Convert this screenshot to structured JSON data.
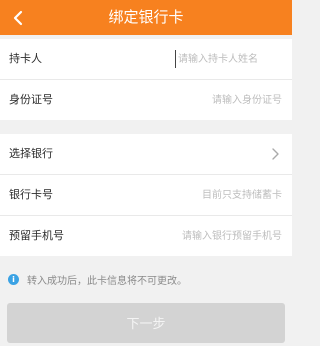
{
  "header": {
    "title": "绑定银行卡",
    "back_icon": "chevron-left-icon",
    "color": "#f7811f"
  },
  "section1": {
    "rows": [
      {
        "label": "持卡人",
        "placeholder": "请输入持卡人姓名",
        "value": ""
      },
      {
        "label": "身份证号",
        "placeholder": "请输入身份证号",
        "value": ""
      }
    ]
  },
  "section2": {
    "bank": {
      "label": "选择银行",
      "icon": "chevron-right-icon"
    },
    "card_number": {
      "label": "银行卡号",
      "placeholder": "目前只支持储蓄卡",
      "value": ""
    },
    "phone": {
      "label": "预留手机号",
      "placeholder": "请输入银行预留手机号",
      "value": ""
    }
  },
  "notice": {
    "icon": "info-icon",
    "text": "转入成功后，此卡信息将不可更改。",
    "icon_color": "#3aa2e4"
  },
  "next_button": {
    "label": "下一步",
    "color": "#d3d3d3"
  }
}
